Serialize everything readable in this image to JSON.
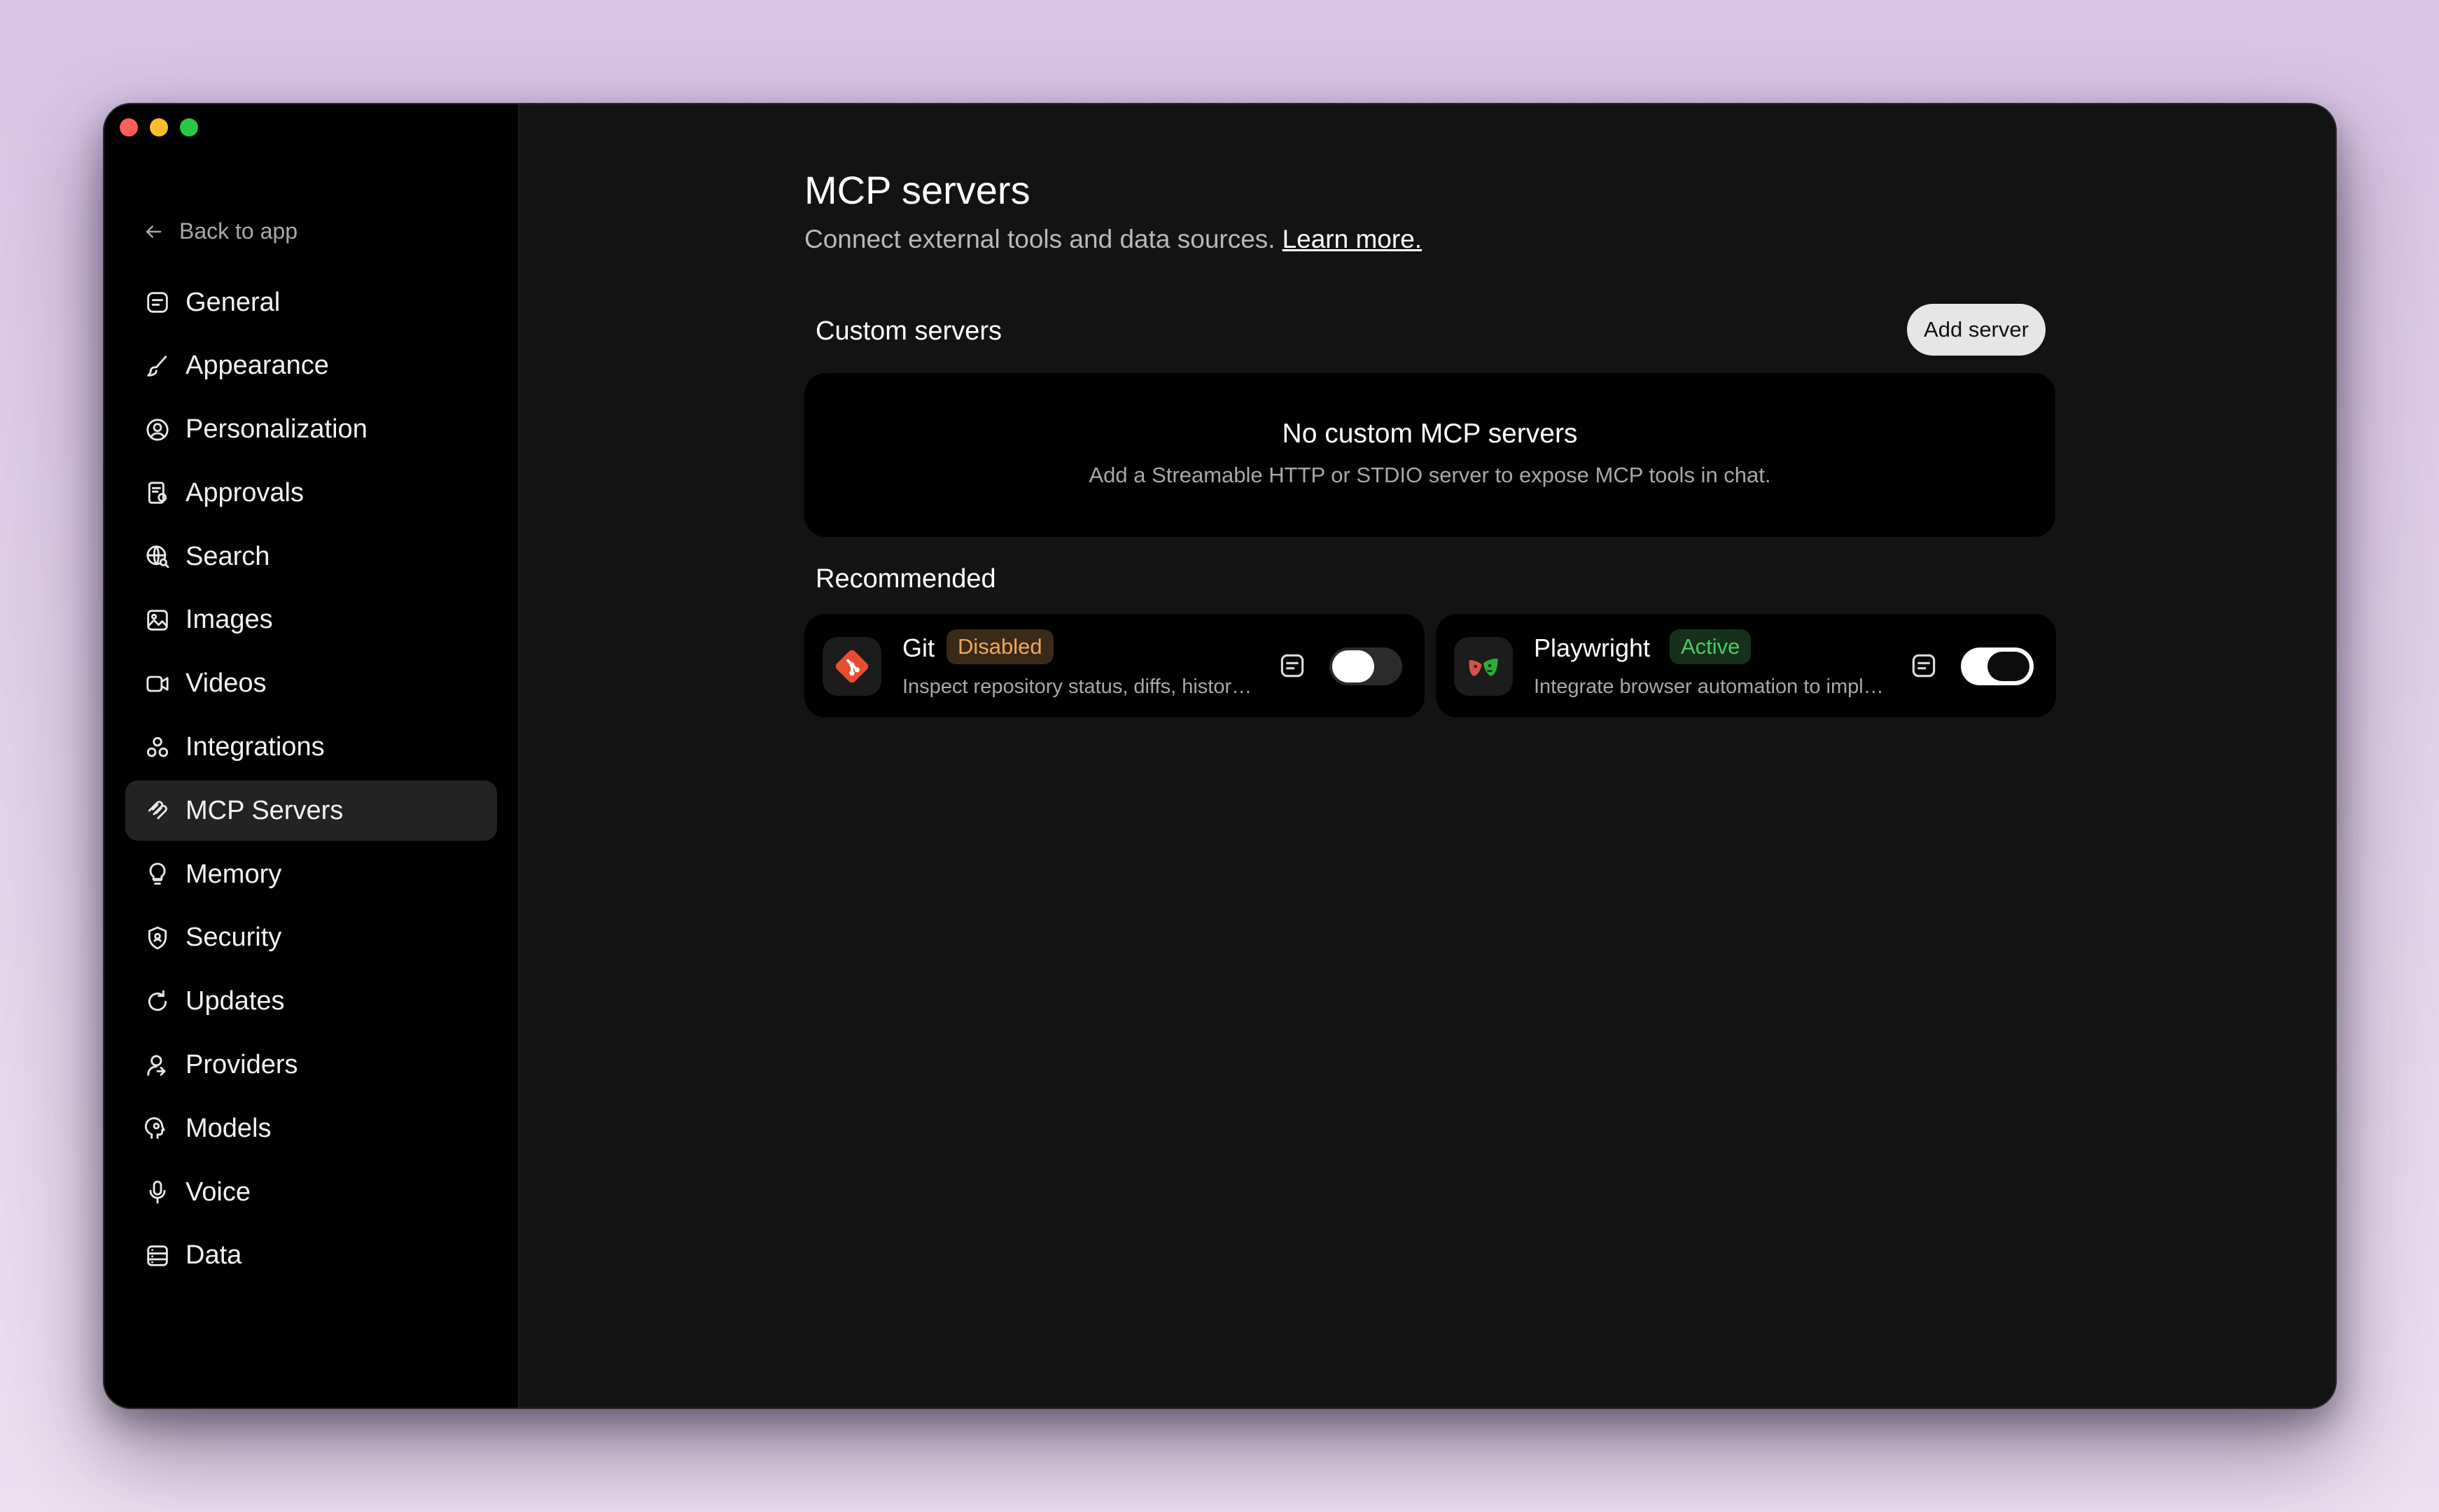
{
  "sidebar": {
    "back_label": "Back to app",
    "items": [
      {
        "label": "General",
        "icon": "general-icon"
      },
      {
        "label": "Appearance",
        "icon": "brush-icon"
      },
      {
        "label": "Personalization",
        "icon": "user-circle-icon"
      },
      {
        "label": "Approvals",
        "icon": "approvals-icon"
      },
      {
        "label": "Search",
        "icon": "globe-search-icon"
      },
      {
        "label": "Images",
        "icon": "image-icon"
      },
      {
        "label": "Videos",
        "icon": "video-icon"
      },
      {
        "label": "Integrations",
        "icon": "integrations-icon"
      },
      {
        "label": "MCP Servers",
        "icon": "mcp-icon",
        "active": true
      },
      {
        "label": "Memory",
        "icon": "lightbulb-icon"
      },
      {
        "label": "Security",
        "icon": "shield-icon"
      },
      {
        "label": "Updates",
        "icon": "refresh-icon"
      },
      {
        "label": "Providers",
        "icon": "providers-icon"
      },
      {
        "label": "Models",
        "icon": "head-icon"
      },
      {
        "label": "Voice",
        "icon": "microphone-icon"
      },
      {
        "label": "Data",
        "icon": "database-icon"
      }
    ]
  },
  "main": {
    "title": "MCP servers",
    "subtitle": "Connect external tools and data sources.",
    "learn_more": "Learn more.",
    "custom_section": "Custom servers",
    "add_server": "Add server",
    "empty_title": "No custom MCP servers",
    "empty_desc": "Add a Streamable HTTP or STDIO server to expose MCP tools in chat.",
    "recommended_section": "Recommended",
    "recommended": [
      {
        "name": "Git",
        "status": "Disabled",
        "desc": "Inspect repository status, diffs, history and more",
        "enabled": false,
        "logo": "git-logo-icon"
      },
      {
        "name": "Playwright",
        "status": "Active",
        "desc": "Integrate browser automation to implement tests",
        "enabled": true,
        "logo": "playwright-logo-icon"
      }
    ]
  },
  "colors": {
    "window_bg": "#131313",
    "sidebar_bg": "#000000",
    "badge_disabled": "#f0a857",
    "badge_active": "#4ecb63",
    "git_red": "#e84d31"
  }
}
